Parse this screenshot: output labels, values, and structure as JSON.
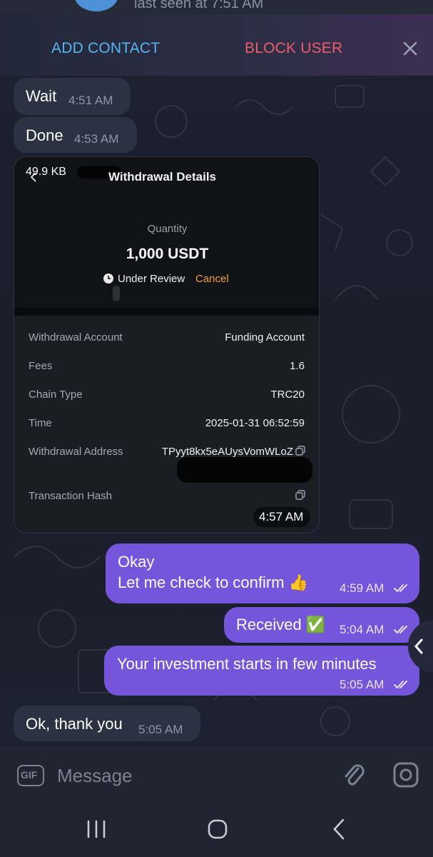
{
  "header": {
    "last_seen": "last seen at 7:51 AM",
    "add_contact_label": "ADD CONTACT",
    "block_user_label": "BLOCK USER"
  },
  "messages": [
    {
      "direction": "in",
      "text": "Wait",
      "time": "4:51 AM"
    },
    {
      "direction": "in",
      "text": "Done",
      "time": "4:53 AM"
    },
    {
      "direction": "in",
      "type": "image",
      "time": "4:57 AM"
    },
    {
      "direction": "out",
      "line1": "Okay",
      "line2": "Let me check to confirm 👍",
      "time": "4:59 AM",
      "read": true
    },
    {
      "direction": "out",
      "text": "Received ✅",
      "time": "5:04 AM",
      "read": true
    },
    {
      "direction": "out",
      "text": "Your investment starts in few minutes",
      "time": "5:05 AM",
      "read": true
    },
    {
      "direction": "in",
      "text": "Ok, thank you",
      "time": "5:05 AM"
    }
  ],
  "image_card": {
    "file_size": "49.9 KB",
    "title": "Withdrawal Details",
    "quantity_label": "Quantity",
    "quantity_value": "1,000 USDT",
    "status": "Under Review",
    "cancel_label": "Cancel",
    "details": [
      {
        "label": "Withdrawal Account",
        "value": "Funding Account"
      },
      {
        "label": "Fees",
        "value": "1.6"
      },
      {
        "label": "Chain Type",
        "value": "TRC20"
      },
      {
        "label": "Time",
        "value": "2025-01-31 06:52:59"
      },
      {
        "label": "Withdrawal Address",
        "value": "TPyyt8kx5eAUysVomWLoZ"
      },
      {
        "label": "Transaction Hash",
        "value": ""
      }
    ]
  },
  "input": {
    "placeholder": "Message",
    "gif_label": "GIF"
  },
  "colors": {
    "outgoing_bubble": "#7555da",
    "incoming_bubble": "#2b3242",
    "add_contact": "#5ab4f0",
    "block_user": "#ec5d6a",
    "cancel_accent": "#f0a030"
  }
}
